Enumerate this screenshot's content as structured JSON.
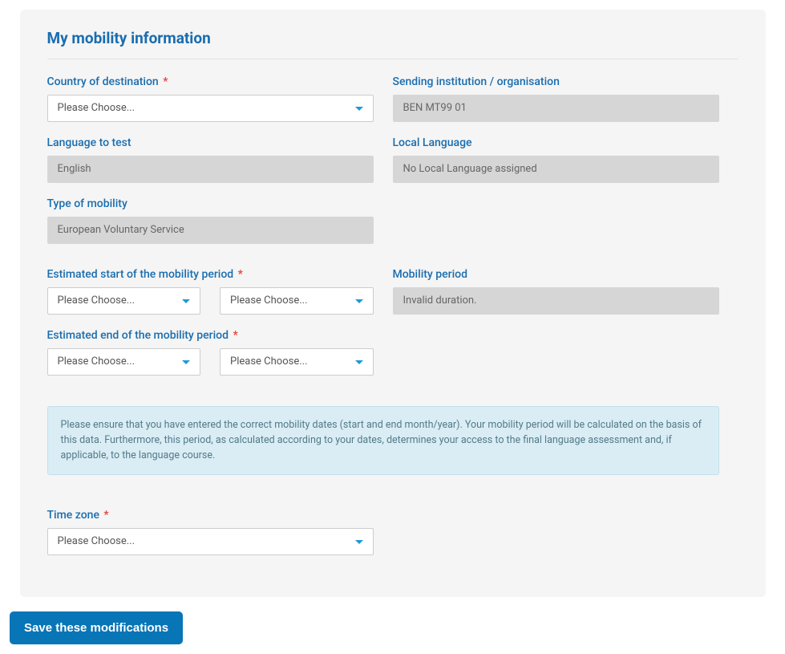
{
  "title": "My mobility information",
  "placeholder": "Please Choose...",
  "fields": {
    "country": {
      "label": "Country of destination"
    },
    "sendingInst": {
      "label": "Sending institution / organisation",
      "value": "BEN MT99 01"
    },
    "languageTest": {
      "label": "Language to test",
      "value": "English"
    },
    "localLanguage": {
      "label": "Local Language",
      "value": "No Local Language assigned"
    },
    "mobilityType": {
      "label": "Type of mobility",
      "value": "European Voluntary Service"
    },
    "startPeriod": {
      "label": "Estimated start of the mobility period"
    },
    "mobilityPeriod": {
      "label": "Mobility period",
      "value": "Invalid duration."
    },
    "endPeriod": {
      "label": "Estimated end of the mobility period"
    },
    "timezone": {
      "label": "Time zone"
    }
  },
  "infoText": "Please ensure that you have entered the correct mobility dates (start and end month/year). Your mobility period will be calculated on the basis of this data. Furthermore, this period, as calculated according to your dates, determines your access to the final language assessment and, if applicable, to the language course.",
  "saveButton": "Save these modifications"
}
